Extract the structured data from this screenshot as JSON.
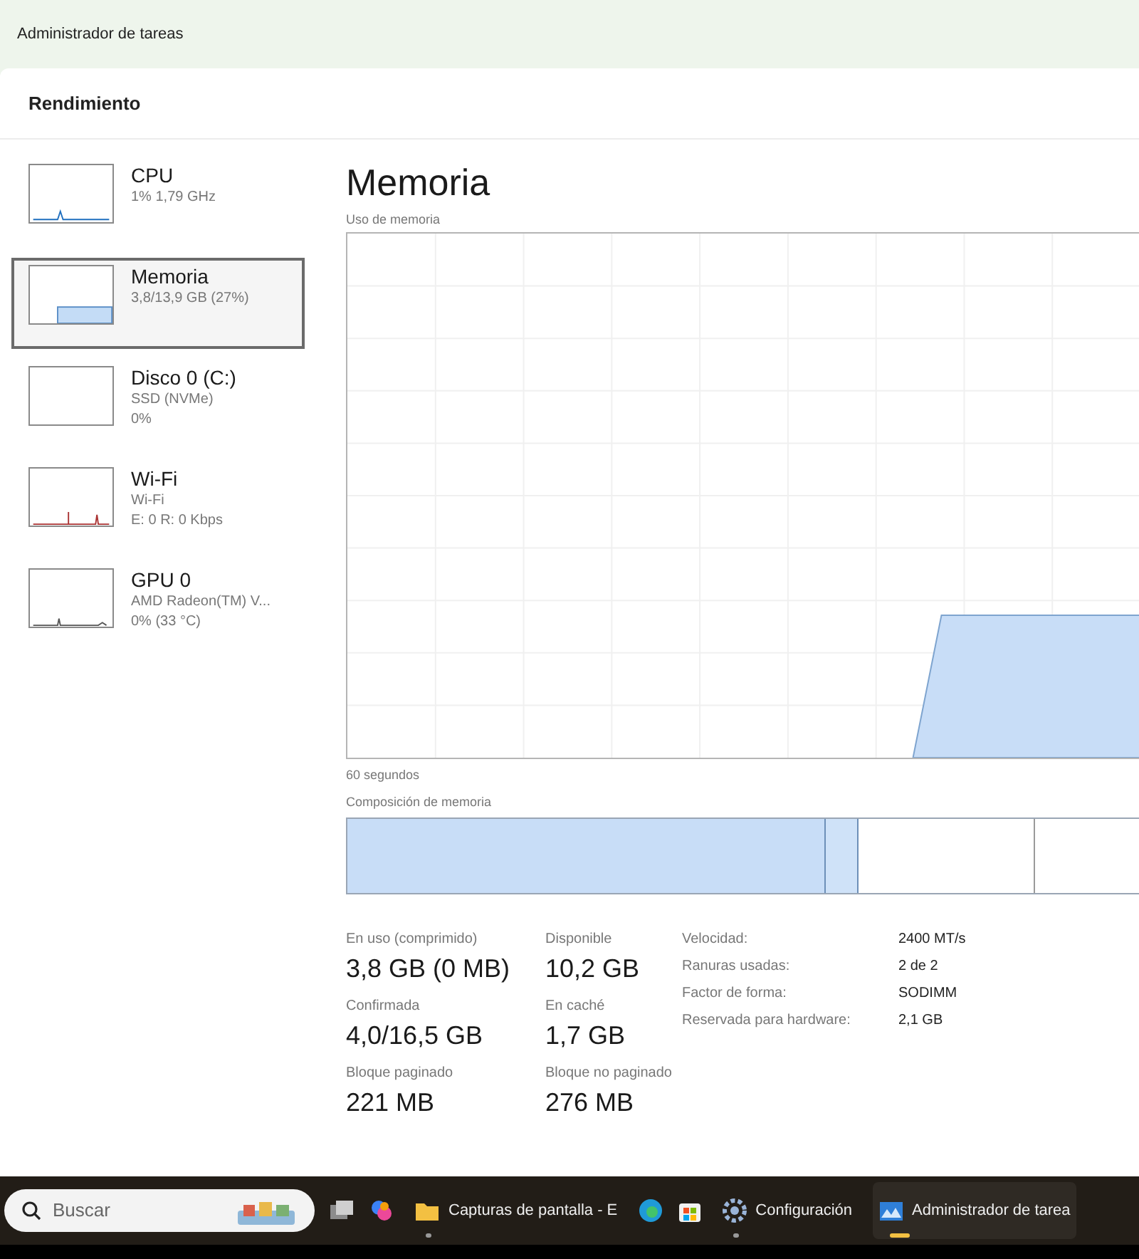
{
  "window": {
    "title": "Administrador de tareas"
  },
  "page_title": "Rendimiento",
  "sidebar": {
    "items": [
      {
        "kind": "cpu",
        "title": "CPU",
        "lines": [
          "1% 1,79 GHz"
        ],
        "selected": false
      },
      {
        "kind": "memory",
        "title": "Memoria",
        "lines": [
          "3,8/13,9 GB (27%)"
        ],
        "selected": true
      },
      {
        "kind": "disk",
        "title": "Disco 0 (C:)",
        "lines": [
          "SSD (NVMe)",
          "0%"
        ],
        "selected": false
      },
      {
        "kind": "network",
        "title": "Wi-Fi",
        "lines": [
          "Wi-Fi",
          "E: 0 R: 0 Kbps"
        ],
        "selected": false
      },
      {
        "kind": "gpu",
        "title": "GPU 0",
        "lines": [
          "AMD Radeon(TM) V...",
          "0% (33 °C)"
        ],
        "selected": false
      }
    ]
  },
  "main": {
    "title": "Memoria",
    "chart_label": "Uso de memoria",
    "time_label": "60 segundos",
    "composition_label": "Composición de memoria",
    "stats": [
      {
        "label": "En uso (comprimido)",
        "value": "3,8 GB (0 MB)"
      },
      {
        "label": "Disponible",
        "value": "10,2 GB"
      },
      {
        "label": "Confirmada",
        "value": "4,0/16,5 GB"
      },
      {
        "label": "En caché",
        "value": "1,7 GB"
      },
      {
        "label": "Bloque paginado",
        "value": "221 MB"
      },
      {
        "label": "Bloque no paginado",
        "value": "276 MB"
      }
    ],
    "specs": [
      {
        "label": "Velocidad:",
        "value": "2400 MT/s"
      },
      {
        "label": "Ranuras usadas:",
        "value": "2 de 2"
      },
      {
        "label": "Factor de forma:",
        "value": "SODIMM"
      },
      {
        "label": "Reservada para hardware:",
        "value": "2,1 GB"
      }
    ]
  },
  "taskbar": {
    "search": {
      "placeholder": "Buscar"
    },
    "items": [
      {
        "kind": "taskview"
      },
      {
        "kind": "copilot"
      },
      {
        "kind": "folder",
        "label": "Capturas de pantalla - E",
        "selected": false
      },
      {
        "kind": "edge"
      },
      {
        "kind": "store"
      },
      {
        "kind": "settings",
        "label": "Configuración",
        "selected": false
      },
      {
        "kind": "taskmanager",
        "label": "Administrador de tarea",
        "selected": true
      }
    ]
  }
}
